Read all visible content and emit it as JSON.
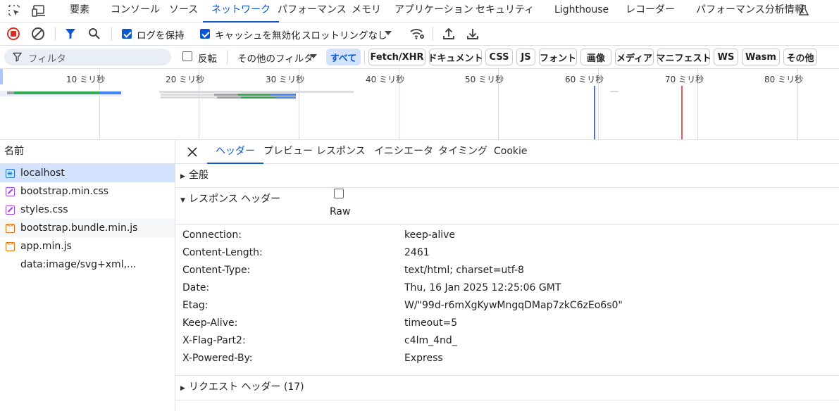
{
  "devtools_tabs": [
    "要素",
    "コンソール",
    "ソース",
    "ネットワーク",
    "パフォーマンス",
    "メモリ",
    "アプリケーション",
    "セキュリティ",
    "Lighthouse",
    "レコーダー",
    "パフォーマンス分析情報"
  ],
  "active_tab": "ネットワーク",
  "toolbar": {
    "preserve_log_label": "ログを保持",
    "preserve_log_checked": true,
    "disable_cache_label": "キャッシュを無効化",
    "disable_cache_checked": true,
    "throttling_value": "スロットリングなし"
  },
  "filterbar": {
    "filter_placeholder": "フィルタ",
    "invert_label": "反転",
    "more_filters_label": "その他のフィルタ",
    "types": [
      "すべて",
      "Fetch/XHR",
      "ドキュメント",
      "CSS",
      "JS",
      "フォント",
      "画像",
      "メディア",
      "マニフェスト",
      "WS",
      "Wasm",
      "その他"
    ],
    "active_type": "すべて"
  },
  "timeline": {
    "ticks": [
      "10 ミリ秒",
      "20 ミリ秒",
      "30 ミリ秒",
      "40 ミリ秒",
      "50 ミリ秒",
      "60 ミリ秒",
      "70 ミリ秒",
      "80 ミリ秒"
    ]
  },
  "request_list": {
    "header": "名前",
    "items": [
      {
        "name": "localhost",
        "type": "doc",
        "selected": true
      },
      {
        "name": "bootstrap.min.css",
        "type": "css"
      },
      {
        "name": "styles.css",
        "type": "css"
      },
      {
        "name": "bootstrap.bundle.min.js",
        "type": "js"
      },
      {
        "name": "app.min.js",
        "type": "js"
      },
      {
        "name": "data:image/svg+xml,...",
        "type": "none"
      }
    ]
  },
  "details": {
    "tabs": [
      "ヘッダー",
      "プレビュー",
      "レスポンス",
      "イニシエータ",
      "タイミング",
      "Cookie"
    ],
    "active_tab": "ヘッダー",
    "general_label": "全般",
    "response_headers_label": "レスポンス ヘッダー",
    "raw_label": "Raw",
    "raw_checked": false,
    "response_headers": [
      {
        "name": "Connection:",
        "value": "keep-alive"
      },
      {
        "name": "Content-Length:",
        "value": "2461"
      },
      {
        "name": "Content-Type:",
        "value": "text/html; charset=utf-8"
      },
      {
        "name": "Date:",
        "value": "Thu, 16 Jan 2025 12:25:06 GMT"
      },
      {
        "name": "Etag:",
        "value": "W/\"99d-r6mXgKywMngqDMap7zkC6zEo6s0\""
      },
      {
        "name": "Keep-Alive:",
        "value": "timeout=5"
      },
      {
        "name": "X-Flag-Part2:",
        "value": "c4lm_4nd_"
      },
      {
        "name": "X-Powered-By:",
        "value": "Express"
      }
    ],
    "request_headers_label": "リクエスト ヘッダー (17)"
  },
  "colors": {
    "accent": "#0b57d0",
    "record_red": "#d93025",
    "bar_green": "#34a853",
    "bar_blue": "#4285f4",
    "bar_gray": "#9aa0a6"
  }
}
